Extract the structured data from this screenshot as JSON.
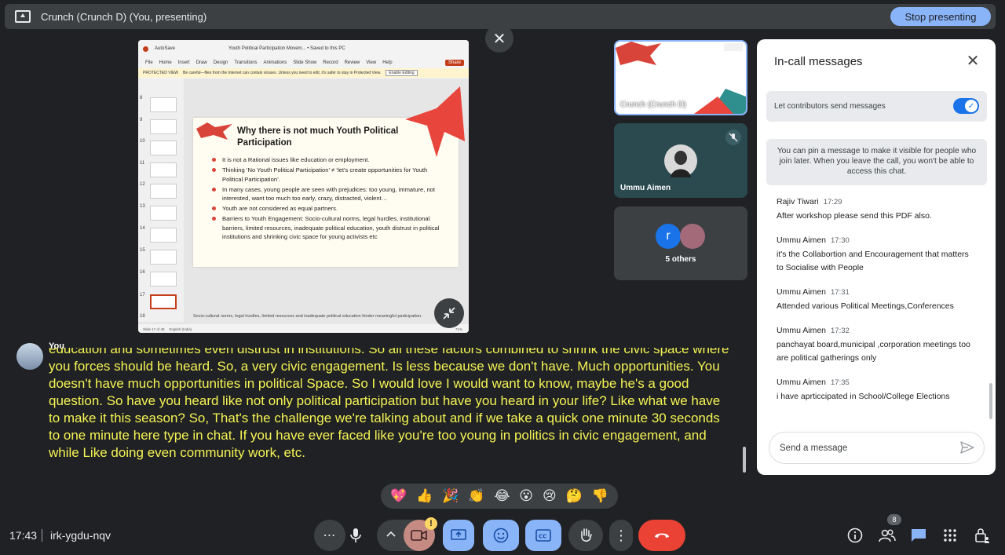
{
  "topbar": {
    "title": "Crunch (Crunch D) (You, presenting)",
    "stop_label": "Stop presenting"
  },
  "ppt": {
    "app_autosave": "AutoSave",
    "doc_name": "Youth Political Participation Movem... • Saved to this PC",
    "menu": [
      "File",
      "Home",
      "Insert",
      "Draw",
      "Design",
      "Transitions",
      "Animations",
      "Slide Show",
      "Record",
      "Review",
      "View",
      "Help"
    ],
    "share": "Share",
    "protected_label": "PROTECTED VIEW",
    "protected_msg": "Be careful—files from the Internet can contain viruses. Unless you need to edit, it's safer to stay in Protected View.",
    "enable_editing": "Enable Editing",
    "thumb_numbers": [
      "8",
      "9",
      "10",
      "11",
      "12",
      "13",
      "14",
      "15",
      "16",
      "17",
      "18"
    ],
    "slide_heading": "Why there is not much Youth Political Participation",
    "bullets": [
      "It is not a Rational issues like education or employment.",
      "Thinking ‘No Youth Political Participation’ ≠ ‘let’s create opportunities for Youth Political Participation’.",
      "In many cases, young people are seen with prejudices: too young, immature, not interested, want too much too early, crazy, distracted, violent…",
      "Youth are not considered as equal partners.",
      "Barriers to Youth Engagement: Socio-cultural norms, legal hurdles, institutional barriers, limited resources, inadequate political education, youth distrust in political institutions and shrinking civic space for young activists etc"
    ],
    "notes": "Socio-cultural norms, legal hurdles, limited resources and inadequate political education hinder meaningful participation.",
    "status_slide": "Slide 17 of 48",
    "status_lang": "English (India)",
    "status_zoom": "71%"
  },
  "tiles": {
    "self_label": "Crunch (Crunch D)",
    "ummu_label": "Ummu Aimen",
    "others_initial": "r",
    "others_label": "5 others"
  },
  "caption": {
    "speaker": "You",
    "text": "education and sometimes even distrust in institutions. So all these factors combined to shrink the civic space where you forces should be heard. So, a very civic engagement. Is less because we don't have. Much opportunities. You doesn't have much opportunities in political Space. So I would love I would want to know, maybe he's a good question. So have you heard like not only political participation but have you heard in your life? Like what we have to make it this season? So, That's the challenge we're talking about and if we take a quick one minute 30 seconds to one minute here type in chat. If you have ever faced like you're too young in politics in civic engagement, and while Like doing even community work, etc."
  },
  "reactions": [
    "💖",
    "👍",
    "🎉",
    "👏",
    "😂",
    "😮",
    "😢",
    "🤔",
    "👎"
  ],
  "bottom": {
    "time": "17:43",
    "meeting_code": "irk-ygdu-nqv",
    "people_count": "8"
  },
  "chat": {
    "title": "In-call messages",
    "toggle_label": "Let contributors send messages",
    "pin_note": "You can pin a message to make it visible for people who join later. When you leave the call, you won't be able to access this chat.",
    "messages": [
      {
        "sender": "Rajiv Tiwari",
        "time": "17:29",
        "text": "After workshop please send this PDF also."
      },
      {
        "sender": "Ummu Aimen",
        "time": "17:30",
        "text": "it's the Collabortion and Encouragement that matters to Socialise with People"
      },
      {
        "sender": "Ummu Aimen",
        "time": "17:31",
        "text": "Attended various Political Meetings,Conferences"
      },
      {
        "sender": "Ummu Aimen",
        "time": "17:32",
        "text": "panchayat board,municipal ,corporation meetings too are political gatherings only"
      },
      {
        "sender": "Ummu Aimen",
        "time": "17:35",
        "text": "i have aprticcipated in School/College Elections"
      }
    ],
    "input_placeholder": "Send a message"
  },
  "colors": {
    "accent": "#8ab4f8",
    "end_call": "#ea4335",
    "caption_text": "#f4f454",
    "toggle_on": "#1a73e8"
  }
}
